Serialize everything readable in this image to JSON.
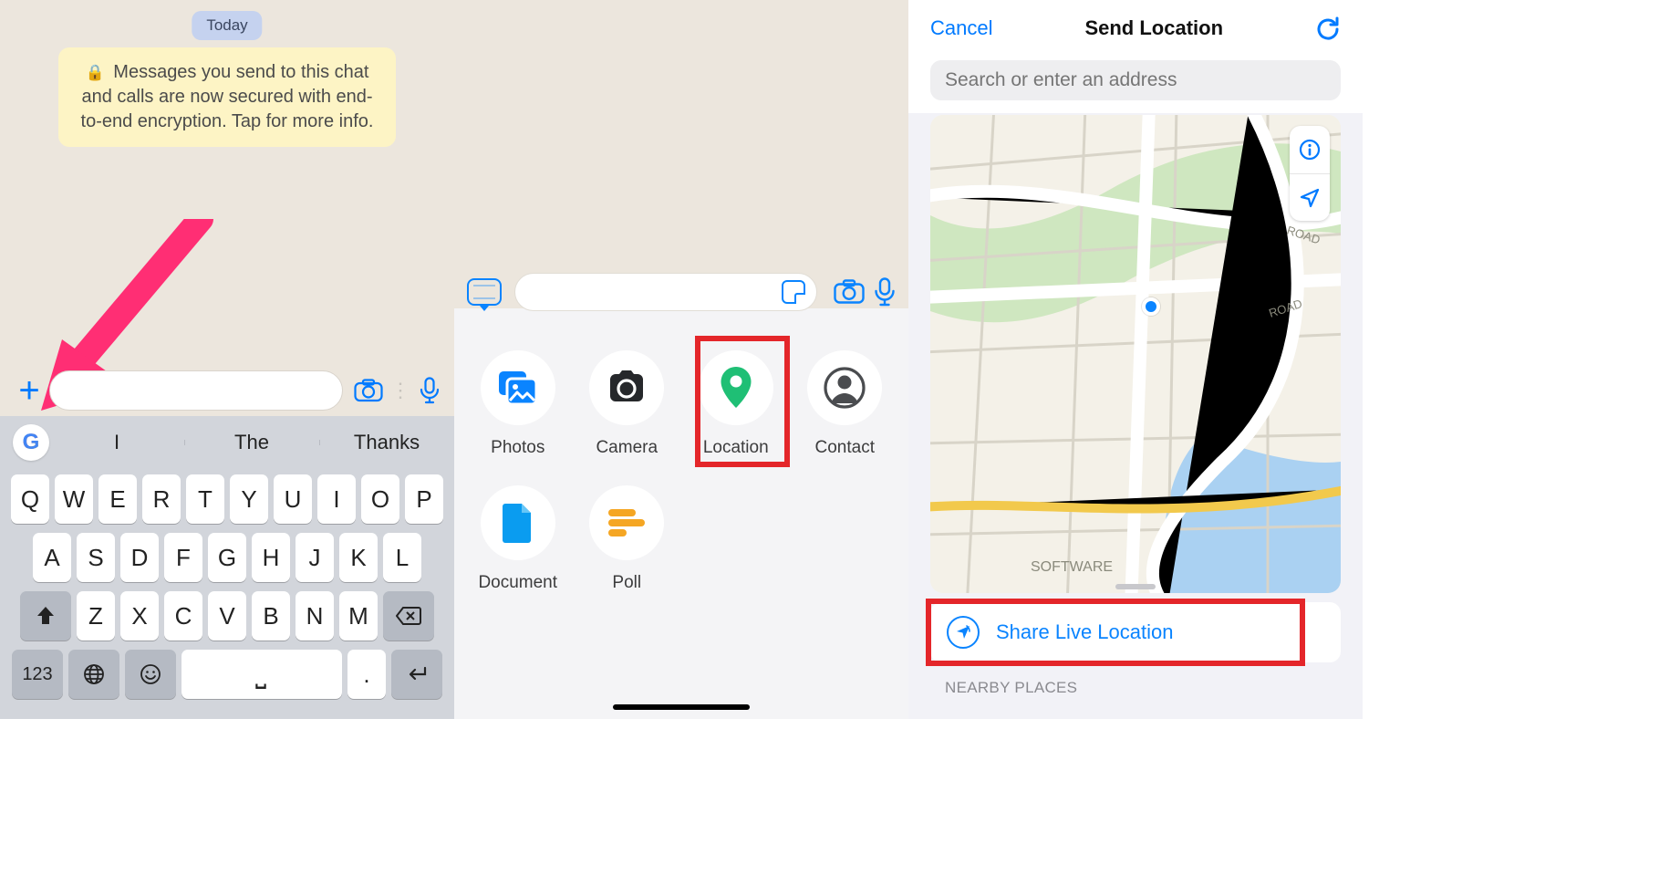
{
  "panel1": {
    "today_label": "Today",
    "encryption_notice": "Messages you send to this chat and calls are now secured with end-to-end encryption. Tap for more info.",
    "message_placeholder": "",
    "suggestions": [
      "I",
      "The",
      "Thanks"
    ],
    "keyboard": {
      "row1": [
        "Q",
        "W",
        "E",
        "R",
        "T",
        "Y",
        "U",
        "I",
        "O",
        "P"
      ],
      "row2": [
        "A",
        "S",
        "D",
        "F",
        "G",
        "H",
        "J",
        "K",
        "L"
      ],
      "row3": [
        "Z",
        "X",
        "C",
        "V",
        "B",
        "N",
        "M"
      ],
      "num_key": "123",
      "period_key": "."
    }
  },
  "panel2": {
    "message_placeholder": "",
    "items": [
      {
        "label": "Photos"
      },
      {
        "label": "Camera"
      },
      {
        "label": "Location"
      },
      {
        "label": "Contact"
      },
      {
        "label": "Document"
      },
      {
        "label": "Poll"
      }
    ]
  },
  "panel3": {
    "cancel": "Cancel",
    "title": "Send Location",
    "search_placeholder": "Search or enter an address",
    "map_labels": [
      "SOFTWARE",
      "ROAD"
    ],
    "share_live": "Share Live Location",
    "nearby_header": "NEARBY PLACES"
  }
}
